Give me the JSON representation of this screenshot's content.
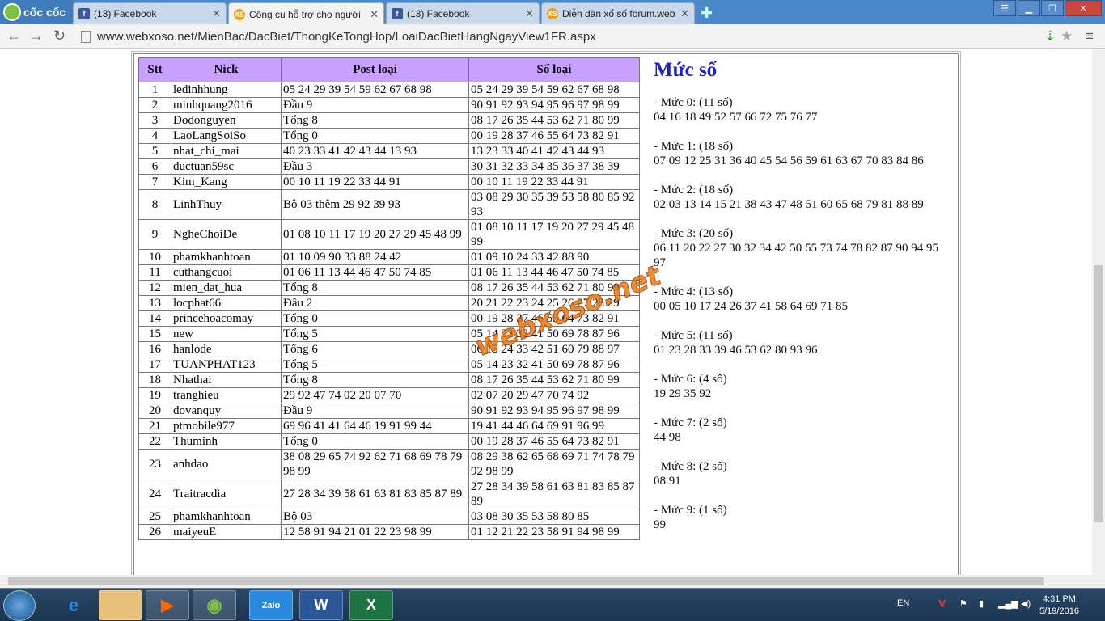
{
  "browser": {
    "brand": "cốc cốc",
    "tabs": [
      {
        "title": "(13) Facebook",
        "icon": "facebook-icon"
      },
      {
        "title": "Công cụ hỗ trợ cho người",
        "icon": "xs-icon"
      },
      {
        "title": "(13) Facebook",
        "icon": "facebook-icon"
      },
      {
        "title": "Diễn đàn xổ số forum.web",
        "icon": "xs-icon"
      }
    ],
    "url": "www.webxoso.net/MienBac/DacBiet/ThongKeTongHop/LoaiDacBietHangNgayView1FR.aspx",
    "xs_badge": "XS"
  },
  "table": {
    "headers": [
      "Stt",
      "Nick",
      "Post loại",
      "Số loại"
    ],
    "rows": [
      [
        "1",
        "ledinhhung",
        "05 24 29 39 54 59 62 67 68 98",
        "05 24 29 39 54 59 62 67 68 98"
      ],
      [
        "2",
        "minhquang2016",
        "Đầu 9",
        "90 91 92 93 94 95 96 97 98 99"
      ],
      [
        "3",
        "Dodonguyen",
        "Tổng 8",
        "08 17 26 35 44 53 62 71 80 99"
      ],
      [
        "4",
        "LaoLangSoiSo",
        "Tổng 0",
        "00 19 28 37 46 55 64 73 82 91"
      ],
      [
        "5",
        "nhat_chi_mai",
        "40 23 33 41 42 43 44 13 93",
        "13 23 33 40 41 42 43 44 93"
      ],
      [
        "6",
        "ductuan59sc",
        "Đầu 3",
        "30 31 32 33 34 35 36 37 38 39"
      ],
      [
        "7",
        "Kim_Kang",
        "00 10 11 19 22 33 44 91",
        "00 10 11 19 22 33 44 91"
      ],
      [
        "8",
        "LinhThuy",
        "Bộ 03 thêm 29 92 39 93",
        "03 08 29 30 35 39 53 58 80 85 92 93"
      ],
      [
        "9",
        "NgheChoiDe",
        "01 08 10 11 17 19 20 27 29 45 48 99",
        "01 08 10 11 17 19 20 27 29 45 48 99"
      ],
      [
        "10",
        "phamkhanhtoan",
        "01 10 09 90 33 88 24 42",
        "01 09 10 24 33 42 88 90"
      ],
      [
        "11",
        "cuthangcuoi",
        "01 06 11 13 44 46 47 50 74 85",
        "01 06 11 13 44 46 47 50 74 85"
      ],
      [
        "12",
        "mien_dat_hua",
        "Tổng 8",
        "08 17 26 35 44 53 62 71 80 99"
      ],
      [
        "13",
        "locphat66",
        "Đầu 2",
        "20 21 22 23 24 25 26 27 28 29"
      ],
      [
        "14",
        "princehoacomay",
        "Tổng 0",
        "00 19 28 37 46 55 64 73 82 91"
      ],
      [
        "15",
        "new",
        "Tổng 5",
        "05 14 23 32 41 50 69 78 87 96"
      ],
      [
        "16",
        "hanlode",
        "Tổng 6",
        "06 15 24 33 42 51 60 79 88 97"
      ],
      [
        "17",
        "TUANPHAT123",
        "Tổng 5",
        "05 14 23 32 41 50 69 78 87 96"
      ],
      [
        "18",
        "Nhathai",
        "Tổng 8",
        "08 17 26 35 44 53 62 71 80 99"
      ],
      [
        "19",
        "tranghieu",
        "29 92 47 74 02 20 07 70",
        "02 07 20 29 47 70 74 92"
      ],
      [
        "20",
        "dovanquy",
        "Đầu 9",
        "90 91 92 93 94 95 96 97 98 99"
      ],
      [
        "21",
        "ptmobile977",
        "69 96 41 41 64 46 19 91 99 44",
        "19 41 44 46 64 69 91 96 99"
      ],
      [
        "22",
        "Thuminh",
        "Tổng 0",
        "00 19 28 37 46 55 64 73 82 91"
      ],
      [
        "23",
        "anhdao",
        "38 08 29 65 74 92 62 71 68 69 78 79 98 99",
        "08 29 38 62 65 68 69 71 74 78 79 92 98 99"
      ],
      [
        "24",
        "Traitracdia",
        "27 28 34 39 58 61 63 81 83 85 87 89",
        "27 28 34 39 58 61 63 81 83 85 87 89"
      ],
      [
        "25",
        "phamkhanhtoan",
        "Bộ 03",
        "03 08 30 35 53 58 80 85"
      ],
      [
        "26",
        "maiyeuE",
        "12 58 91 94 21 01 22 23 98 99",
        "01 12 21 22 23 58 91 94 98 99"
      ]
    ]
  },
  "muc": {
    "title": "Mức số",
    "levels": [
      {
        "label": "- Mức 0: (11 số)",
        "nums": "04 16 18 49 52 57 66 72 75 76 77"
      },
      {
        "label": "- Mức 1: (18 số)",
        "nums": "07 09 12 25 31 36 40 45 54 56 59 61 63 67 70 83 84 86"
      },
      {
        "label": "- Mức 2: (18 số)",
        "nums": "02 03 13 14 15 21 38 43 47 48 51 60 65 68 79 81 88 89"
      },
      {
        "label": "- Mức 3: (20 số)",
        "nums": "06 11 20 22 27 30 32 34 42 50 55 73 74 78 82 87 90 94 95 97"
      },
      {
        "label": "- Mức 4: (13 số)",
        "nums": "00 05 10 17 24 26 37 41 58 64 69 71 85"
      },
      {
        "label": "- Mức 5: (11 số)",
        "nums": "01 23 28 33 39 46 53 62 80 93 96"
      },
      {
        "label": "- Mức 6: (4 số)",
        "nums": "19 29 35 92"
      },
      {
        "label": "- Mức 7: (2 số)",
        "nums": "44 98"
      },
      {
        "label": "- Mức 8: (2 số)",
        "nums": "08 91"
      },
      {
        "label": "- Mức 9: (1 số)",
        "nums": "99"
      }
    ]
  },
  "watermark": "webxoso.net",
  "taskbar": {
    "apps": [
      "explorer-icon",
      "media-player-icon",
      "coccoc-icon",
      "zalo-icon",
      "word-icon",
      "excel-icon"
    ],
    "zalo_label": "Zalo",
    "word_label": "W",
    "excel_label": "X",
    "lang": "EN",
    "time": "4:31 PM",
    "date": "5/19/2016"
  }
}
